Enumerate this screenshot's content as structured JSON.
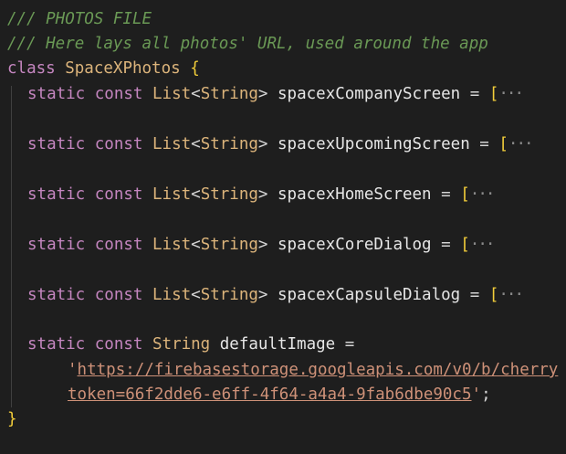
{
  "code": {
    "comment_1": "/// PHOTOS FILE",
    "comment_2": "/// Here lays all photos' URL, used around the app",
    "class_keyword": "class",
    "class_name": "SpaceXPhotos",
    "open_brace": "{",
    "close_brace": "}",
    "static_kw": "static",
    "const_kw": "const",
    "list_type": "List",
    "lt": "<",
    "gt": ">",
    "string_type": "String",
    "equals": "=",
    "open_bracket": "[",
    "fold_marker": "···",
    "fields": [
      {
        "name": "spacexCompanyScreen"
      },
      {
        "name": "spacexUpcomingScreen"
      },
      {
        "name": "spacexHomeScreen"
      },
      {
        "name": "spacexCoreDialog"
      },
      {
        "name": "spacexCapsuleDialog"
      }
    ],
    "default_image_name": "defaultImage",
    "url_quote": "'",
    "url_line_1": "https://firebasestorage.googleapis.com/v0/b/cherry",
    "url_line_2": "token=66f2dde6-e6ff-4f64-a4a4-9fab6dbe90c5",
    "semicolon": ";"
  },
  "colors": {
    "background": "#1e1e1e",
    "comment": "#6a9955",
    "keyword": "#c586c0",
    "type": "#dcb47b",
    "string": "#ce9178",
    "brace": "#f2cd3a"
  }
}
